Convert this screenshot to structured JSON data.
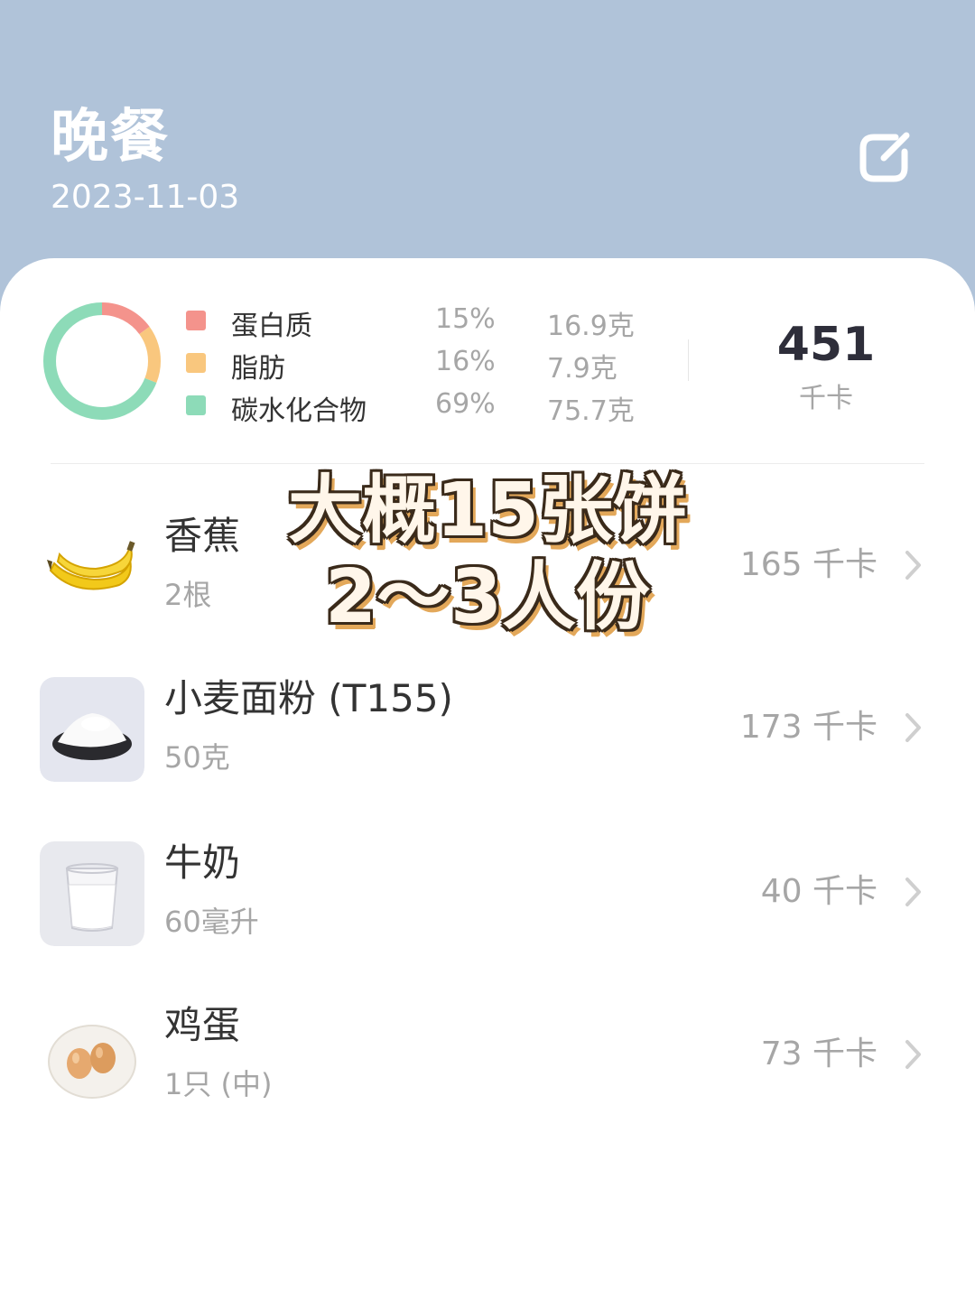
{
  "header": {
    "title": "晚餐",
    "date": "2023-11-03",
    "edit_icon": "edit-icon"
  },
  "summary": {
    "macros": [
      {
        "name": "蛋白质",
        "percent": "15%",
        "amount": "16.9克",
        "color": "#f4938c",
        "fraction": 0.15
      },
      {
        "name": "脂肪",
        "percent": "16%",
        "amount": "7.9克",
        "color": "#f9c77e",
        "fraction": 0.16
      },
      {
        "name": "碳水化合物",
        "percent": "69%",
        "amount": "75.7克",
        "color": "#8ddbb8",
        "fraction": 0.69
      }
    ],
    "total_kcal": "451",
    "kcal_unit": "千卡"
  },
  "foods": [
    {
      "name": "香蕉",
      "qty": "2根",
      "kcal": "165 千卡",
      "icon": "banana-image"
    },
    {
      "name": "小麦面粉 (T155)",
      "qty": "50克",
      "kcal": "173 千卡",
      "icon": "flour-image"
    },
    {
      "name": "牛奶",
      "qty": "60毫升",
      "kcal": "40 千卡",
      "icon": "milk-image"
    },
    {
      "name": "鸡蛋",
      "qty": "1只 (中)",
      "kcal": "73 千卡",
      "icon": "egg-image"
    }
  ],
  "overlay": {
    "line1": "大概15张饼",
    "line2": "2～3人份"
  },
  "colors": {
    "header_bg": "#b0c3d9",
    "text_primary": "#333333",
    "text_secondary": "#a6a6a6"
  }
}
